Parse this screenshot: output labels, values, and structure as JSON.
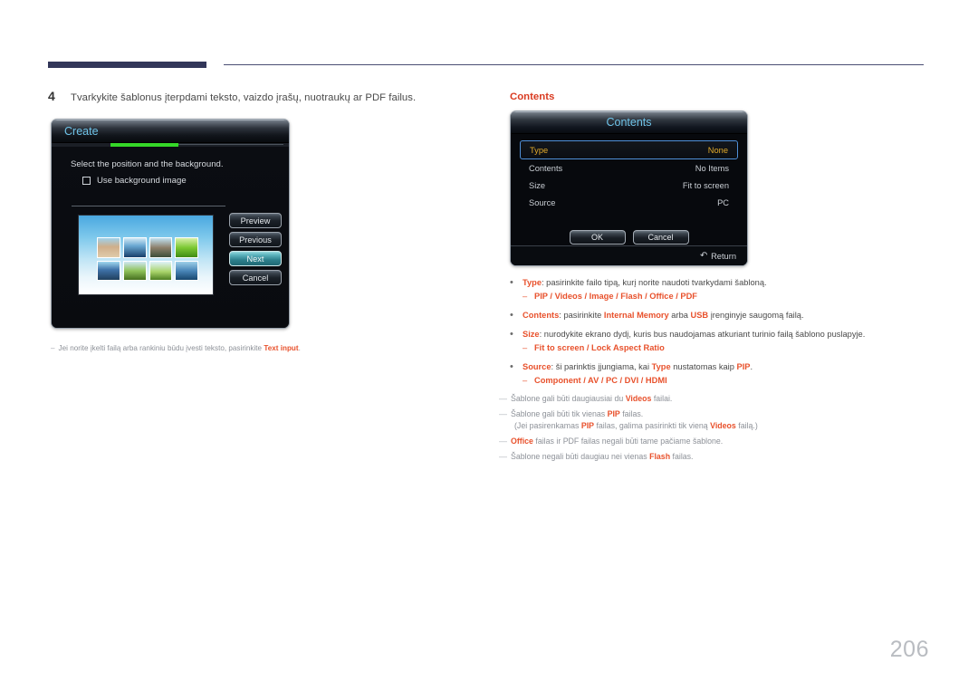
{
  "page": {
    "number": "206"
  },
  "step": {
    "number": "4",
    "text": "Tvarkykite šablonus įterpdami teksto, vaizdo įrašų, nuotraukų ar PDF failus."
  },
  "create_dialog": {
    "title": "Create",
    "prompt": "Select the position and the background.",
    "checkbox_label": "Use background image",
    "checkbox_checked": false,
    "buttons": [
      {
        "label": "Preview",
        "selected": false
      },
      {
        "label": "Previous",
        "selected": false
      },
      {
        "label": "Next",
        "selected": true
      },
      {
        "label": "Cancel",
        "selected": false
      }
    ],
    "progress_color": "#35d728",
    "thumbnail_count": 8
  },
  "create_note": {
    "dash": "–",
    "pre": "Jei norite įkelti failą arba rankiniu būdu įvesti teksto, pasirinkite ",
    "bold": "Text input",
    "post": "."
  },
  "contents_heading": "Contents",
  "contents_dialog": {
    "title": "Contents",
    "rows": [
      {
        "label": "Type",
        "value": "None",
        "active": true
      },
      {
        "label": "Contents",
        "value": "No Items",
        "active": false
      },
      {
        "label": "Size",
        "value": "Fit to screen",
        "active": false
      },
      {
        "label": "Source",
        "value": "PC",
        "active": false
      }
    ],
    "buttons": [
      {
        "label": "OK"
      },
      {
        "label": "Cancel"
      }
    ],
    "footer": {
      "icon": "return-arrow-icon",
      "label": "Return"
    },
    "highlight_color": "#e0a92b",
    "focus_border_color": "#4f8fd8"
  },
  "bullets": [
    {
      "term": "Type",
      "text": ": pasirinkite failo tipą, kurį norite naudoti tvarkydami šabloną.",
      "sub": "PIP / Videos / Image / Flash / Office / PDF"
    },
    {
      "term": "Contents",
      "text": ": pasirinkite Internal Memory arba USB įrenginyje saugomą failą.",
      "sub": null
    },
    {
      "term": "Size",
      "text": ": nurodykite ekrano dydį, kuris bus naudojamas atkuriant turinio failą šablono puslapyje.",
      "sub": "Fit to screen / Lock Aspect Ratio"
    },
    {
      "term": "Source",
      "text": ": ši parinktis įjungiama, kai Type nustatomas kaip PIP.",
      "sub": "Component / AV / PC / DVI / HDMI"
    }
  ],
  "bullet_html": [
    "<b>Type</b>: pasirinkite failo tipą, kurį norite naudoti tvarkydami šabloną.",
    "<b>Contents</b>: pasirinkite <b>Internal Memory</b> arba <b>USB</b> įrenginyje saugomą failą.",
    "<b>Size</b>: nurodykite ekrano dydį, kuris bus naudojamas atkuriant turinio failą šablono puslapyje.",
    "<b>Source</b>: ši parinktis įjungiama, kai <b>Type</b> nustatomas kaip <b>PIP</b>."
  ],
  "notes": [
    "Šablone gali būti daugiausiai du <b>Videos</b> failai.",
    "Šablone gali būti tik vienas <b>PIP</b> failas.<span class=\"l2\">(Jei pasirenkamas <b>PIP</b> failas, galima pasirinkti tik vieną <b>Videos</b> failą.)</span>",
    "<b>Office</b> failas ir PDF failas negali būti tame pačiame šablone.",
    "Šablone negali būti daugiau nei vienas <b>Flash</b> failas."
  ],
  "colors": {
    "accent_red": "#e8512c",
    "heading_red": "#d93b21",
    "header_bar": "#323659",
    "osd_blue_title": "#6fc3e8"
  }
}
